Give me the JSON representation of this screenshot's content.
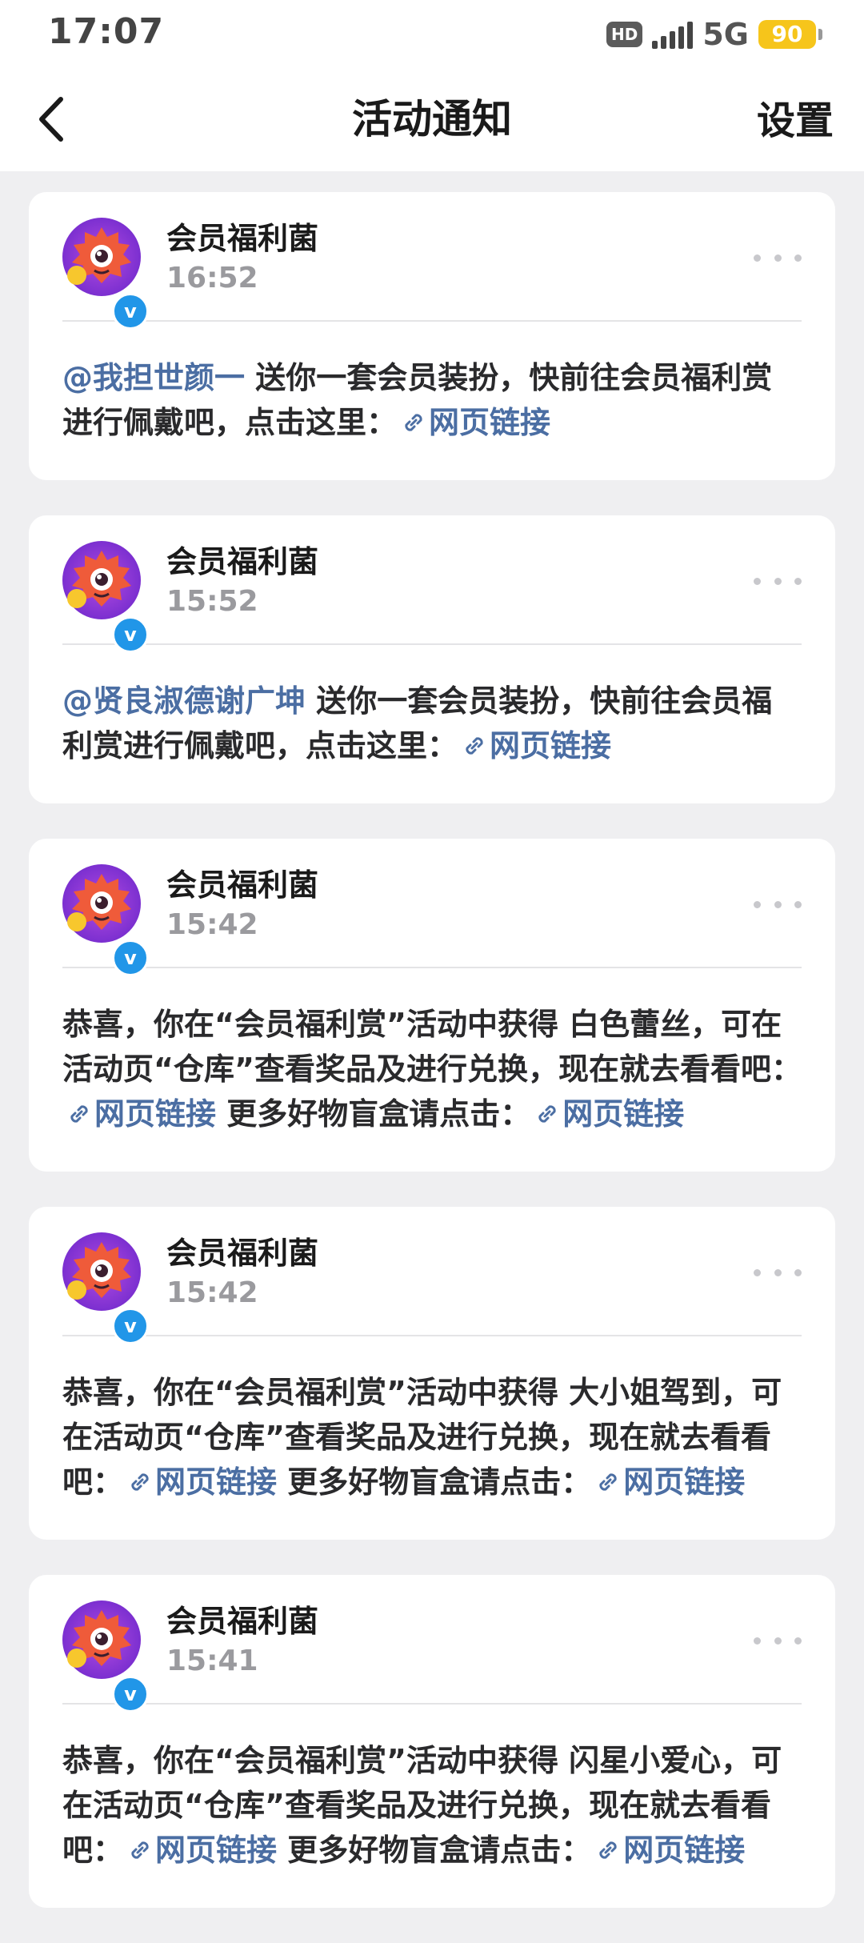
{
  "status_bar": {
    "time": "17:07",
    "hd": "HD",
    "network": "5G",
    "battery": "90"
  },
  "header": {
    "title": "活动通知",
    "settings_label": "设置"
  },
  "cards": [
    {
      "sender": "会员福利菌",
      "time": "16:52",
      "mention": "@我担世颜一",
      "text1": " 送你一套会员装扮，快前往会员福利赏进行佩戴吧，点击这里：",
      "link1": "网页链接",
      "text2": "",
      "link2": ""
    },
    {
      "sender": "会员福利菌",
      "time": "15:52",
      "mention": "@贤良淑德谢广坤",
      "text1": " 送你一套会员装扮，快前往会员福利赏进行佩戴吧，点击这里：",
      "link1": "网页链接",
      "text2": "",
      "link2": ""
    },
    {
      "sender": "会员福利菌",
      "time": "15:42",
      "mention": "",
      "text1": "恭喜，你在“会员福利赏”活动中获得 白色蕾丝，可在活动页“仓库”查看奖品及进行兑换，现在就去看看吧：",
      "link1": "网页链接",
      "text2": " 更多好物盲盒请点击：",
      "link2": "网页链接"
    },
    {
      "sender": "会员福利菌",
      "time": "15:42",
      "mention": "",
      "text1": "恭喜，你在“会员福利赏”活动中获得 大小姐驾到，可在活动页“仓库”查看奖品及进行兑换，现在就去看看吧：",
      "link1": "网页链接",
      "text2": " 更多好物盲盒请点击：",
      "link2": "网页链接"
    },
    {
      "sender": "会员福利菌",
      "time": "15:41",
      "mention": "",
      "text1": "恭喜，你在“会员福利赏”活动中获得 闪星小爱心，可在活动页“仓库”查看奖品及进行兑换，现在就去看看吧：",
      "link1": "网页链接",
      "text2": " 更多好物盲盒请点击：",
      "link2": "网页链接"
    }
  ],
  "icons": {
    "back": "back-arrow-icon",
    "more": "more-dots-icon",
    "link": "link-icon",
    "verified": "verified-icon"
  },
  "colors": {
    "link": "#4b6ea3",
    "verified": "#2196e8",
    "battery": "#f6c51b"
  }
}
